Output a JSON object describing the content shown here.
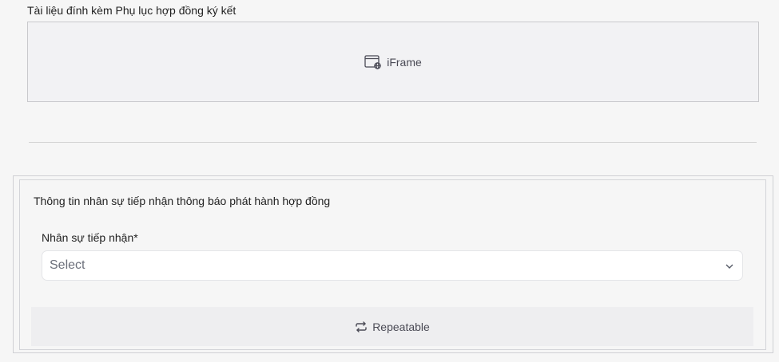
{
  "attachment": {
    "label": "Tài liệu đính kèm Phụ lục hợp đồng ký kết",
    "iframe_label": "iFrame",
    "iframe_icon": "browser-globe-icon"
  },
  "section": {
    "title": "Thông tin nhân sự tiếp nhận thông báo phát hành hợp đồng",
    "field_label": "Nhân sự tiếp nhận*",
    "select_value": "Select",
    "select_icon": "chevron-down-icon",
    "repeatable_label": "Repeatable",
    "repeatable_icon": "repeat-icon"
  }
}
